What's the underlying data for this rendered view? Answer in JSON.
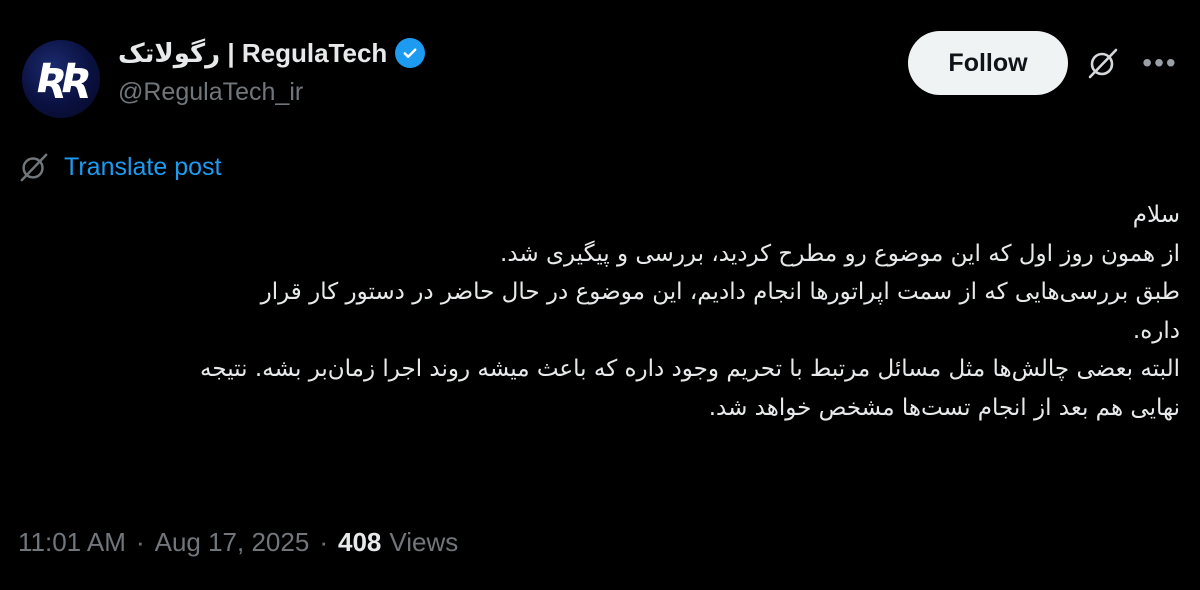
{
  "author": {
    "display_name": "رگولاتک | RegulaTech",
    "handle": "@RegulaTech_ir",
    "avatar_icon": "regulatech-logo-icon",
    "verified_icon": "verified-badge-icon"
  },
  "actions": {
    "follow_label": "Follow",
    "grok_icon": "grok-icon",
    "more_icon": "more-options-icon"
  },
  "translate": {
    "label": "Translate post",
    "icon": "translate-icon"
  },
  "post": {
    "lines": [
      "سلام",
      "از همون روز اول که این موضوع رو مطرح کردید، بررسی و پیگیری شد.",
      "طبق بررسی‌هایی که از سمت اپراتورها انجام دادیم، این موضوع در حال حاضر در دستور کار قرار",
      "داره.",
      "البته بعضی چالش‌ها مثل مسائل مرتبط با تحریم وجود داره که باعث میشه روند اجرا زمان‌بر بشه. نتیجه",
      "نهایی هم بعد از انجام تست‌ها مشخص خواهد شد."
    ]
  },
  "meta": {
    "time": "11:01 AM",
    "separator": "·",
    "date": "Aug 17, 2025",
    "views_count": "408",
    "views_label": "Views"
  },
  "colors": {
    "background": "#000000",
    "text": "#e7e9ea",
    "muted": "#71767b",
    "link": "#1d9bf0",
    "verified": "#1d9bf0",
    "button_bg": "#eff3f4"
  }
}
